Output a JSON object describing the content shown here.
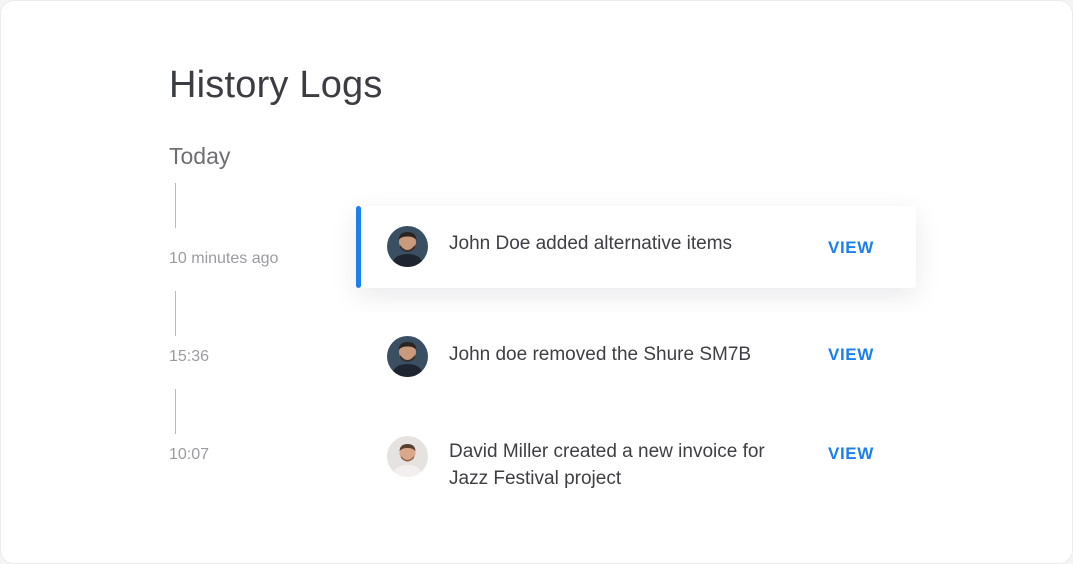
{
  "page": {
    "title": "History Logs",
    "section_label": "Today"
  },
  "timeline": [
    {
      "time": "10 minutes ago"
    },
    {
      "time": "15:36"
    },
    {
      "time": "10:07"
    }
  ],
  "entries": [
    {
      "message": "John Doe added alternative items",
      "action": "VIEW",
      "user": "John Doe",
      "active": true
    },
    {
      "message": "John doe removed the Shure SM7B",
      "action": "VIEW",
      "user": "John Doe",
      "active": false
    },
    {
      "message": "David Miller created a new invoice for Jazz Festival project",
      "action": "VIEW",
      "user": "David Miller",
      "active": false
    }
  ],
  "colors": {
    "accent": "#1a7ff0",
    "title_text": "#3c3d42",
    "muted_text": "#9a9ba1"
  }
}
